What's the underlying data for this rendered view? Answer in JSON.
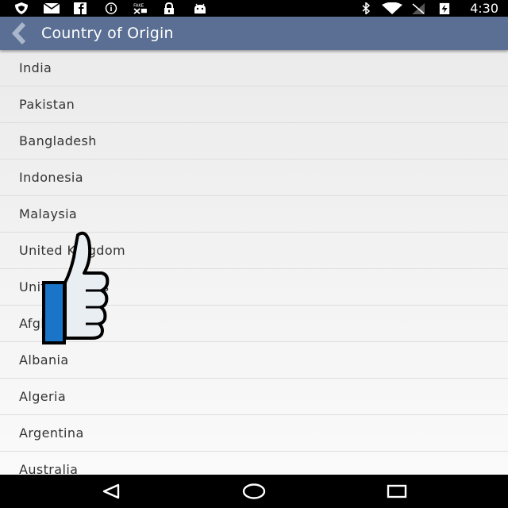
{
  "status_bar": {
    "time": "4:30",
    "left_icons": [
      "shield-icon",
      "email-icon",
      "facebook-icon",
      "info-icon",
      "fake-gps-icon",
      "lock-icon",
      "android-icon"
    ],
    "right_icons": [
      "bluetooth-icon",
      "wifi-icon",
      "no-signal-icon",
      "battery-charging-icon"
    ]
  },
  "app_bar": {
    "title": "Country of Origin",
    "color": "#5a6f93"
  },
  "countries": [
    "India",
    "Pakistan",
    "Bangladesh",
    "Indonesia",
    "Malaysia",
    "United Kingdom",
    "United States",
    "Afghanistan",
    "Albania",
    "Algeria",
    "Argentina",
    "Australia"
  ],
  "overlay": {
    "icon": "thumbs-up-icon",
    "accent_color": "#1a75c9"
  },
  "nav_bar": {
    "icons": [
      "back-triangle-icon",
      "home-circle-icon",
      "recents-square-icon"
    ]
  }
}
